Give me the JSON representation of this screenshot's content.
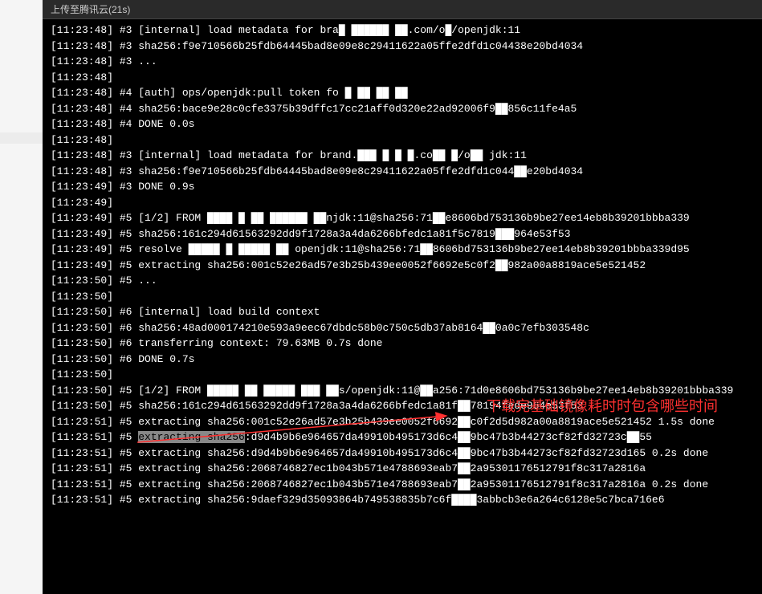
{
  "header": {
    "title": "上传至腾讯云(21s)"
  },
  "annotation": {
    "text": "下载完基础镜像耗时时包含哪些时间"
  },
  "lines": [
    {
      "ts": "[11:23:48]",
      "text": " #3 [internal] load metadata for bra█ ██████ ██.com/o█/openjdk:11"
    },
    {
      "ts": "[11:23:48]",
      "text": " #3 sha256:f9e710566b25fdb64445bad8e09e8c29411622a05ffe2dfd1c04438e20bd4034"
    },
    {
      "ts": "[11:23:48]",
      "text": " #3 ..."
    },
    {
      "ts": "[11:23:48]",
      "text": ""
    },
    {
      "ts": "[11:23:48]",
      "text": " #4 [auth] ops/openjdk:pull token fo █ ██ ██ ██"
    },
    {
      "ts": "[11:23:48]",
      "text": " #4 sha256:bace9e28c0cfe3375b39dffc17cc21aff0d320e22ad92006f9██856c11fe4a5"
    },
    {
      "ts": "[11:23:48]",
      "text": " #4 DONE 0.0s"
    },
    {
      "ts": "[11:23:48]",
      "text": ""
    },
    {
      "ts": "[11:23:48]",
      "text": " #3 [internal] load metadata for brand.███ █ █ █.co██ █/o██ jdk:11"
    },
    {
      "ts": "[11:23:48]",
      "text": " #3 sha256:f9e710566b25fdb64445bad8e09e8c29411622a05ffe2dfd1c044██e20bd4034"
    },
    {
      "ts": "[11:23:49]",
      "text": " #3 DONE 0.9s"
    },
    {
      "ts": "[11:23:49]",
      "text": ""
    },
    {
      "ts": "[11:23:49]",
      "text": " #5 [1/2] FROM ████ █ ██ ██████ ██njdk:11@sha256:71██e8606bd753136b9be27ee14eb8b39201bbba339"
    },
    {
      "ts": "[11:23:49]",
      "text": " #5 sha256:161c294d61563292dd9f1728a3a4da6266bfedc1a81f5c7819███964e53f53"
    },
    {
      "ts": "[11:23:49]",
      "text": " #5 resolve █████ █ █████ ██ openjdk:11@sha256:71██8606bd753136b9be27ee14eb8b39201bbba339d95"
    },
    {
      "ts": "[11:23:49]",
      "text": " #5 extracting sha256:001c52e26ad57e3b25b439ee0052f6692e5c0f2██982a00a8819ace5e521452"
    },
    {
      "ts": "[11:23:50]",
      "text": " #5 ..."
    },
    {
      "ts": "[11:23:50]",
      "text": ""
    },
    {
      "ts": "[11:23:50]",
      "text": " #6 [internal] load build context"
    },
    {
      "ts": "[11:23:50]",
      "text": " #6 sha256:48ad000174210e593a9eec67dbdc58b0c750c5db37ab8164██0a0c7efb303548c"
    },
    {
      "ts": "[11:23:50]",
      "text": " #6 transferring context: 79.63MB 0.7s done"
    },
    {
      "ts": "[11:23:50]",
      "text": " #6 DONE 0.7s"
    },
    {
      "ts": "[11:23:50]",
      "text": ""
    },
    {
      "ts": "[11:23:50]",
      "text": " #5 [1/2] FROM █████ ██ █████ ███ ██s/openjdk:11@██a256:71d0e8606bd753136b9be27ee14eb8b39201bbba339"
    },
    {
      "ts": "[11:23:50]",
      "text": " #5 sha256:161c294d61563292dd9f1728a3a4da6266bfedc1a81f██78194fade964e53f53"
    },
    {
      "ts": "[11:23:51]",
      "text": " #5 extracting sha256:001c52e26ad57e3b25b439ee0052f6692██c0f2d5d982a00a8819ace5e521452 1.5s done"
    },
    {
      "ts": "[11:23:51]",
      "text": " #5 ",
      "hl": "extracting sha256",
      "rest": ":d9d4b9b6e964657da49910b495173d6c4██9bc47b3b44273cf82fd32723c██55"
    },
    {
      "ts": "[11:23:51]",
      "text": " #5 extracting sha256:d9d4b9b6e964657da49910b495173d6c4██9bc47b3b44273cf82fd32723d165 0.2s done"
    },
    {
      "ts": "[11:23:51]",
      "text": " #5 extracting sha256:2068746827ec1b043b571e4788693eab7██2a95301176512791f8c317a2816a"
    },
    {
      "ts": "[11:23:51]",
      "text": " #5 extracting sha256:2068746827ec1b043b571e4788693eab7██2a95301176512791f8c317a2816a 0.2s done"
    },
    {
      "ts": "[11:23:51]",
      "text": " #5 extracting sha256:9daef329d35093864b749538835b7c6f████3abbcb3e6a264c6128e5c7bca716e6"
    }
  ]
}
